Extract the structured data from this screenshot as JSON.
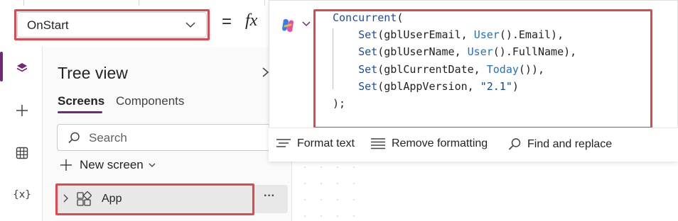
{
  "formula_bar": {
    "property": "OnStart",
    "equals": "=",
    "fx": "fx"
  },
  "editor": {
    "code_lines": [
      {
        "text": "Concurrent(",
        "fn": "Concurrent",
        "rest": "("
      },
      {
        "fn": "Set",
        "a": "(gblUserEmail, ",
        "ctx": "User",
        "b": "().Email),"
      },
      {
        "fn": "Set",
        "a": "(gblUserName, ",
        "ctx": "User",
        "b": "().FullName),"
      },
      {
        "fn": "Set",
        "a": "(gblCurrentDate, ",
        "ctx": "Today",
        "b": "()),"
      },
      {
        "fn": "Set",
        "a": "(gblAppVersion, ",
        "str": "\"2.1\"",
        "b": ")"
      },
      {
        "text": ");"
      }
    ],
    "toolbar": {
      "format_text": "Format text",
      "remove_formatting": "Remove formatting",
      "find_replace": "Find and replace"
    }
  },
  "tree": {
    "title": "Tree view",
    "tabs": [
      "Screens",
      "Components"
    ],
    "active_tab": "Screens",
    "search_placeholder": "Search",
    "new_screen": "New screen",
    "items": [
      {
        "label": "App",
        "more": "···"
      }
    ]
  },
  "rail": {
    "items": [
      "tree-view",
      "insert",
      "data",
      "variables"
    ],
    "variables_label": "{x}"
  },
  "colors": {
    "accent": "#742774",
    "highlight": "#e0474e",
    "code_keyword": "#1c4bb0"
  }
}
